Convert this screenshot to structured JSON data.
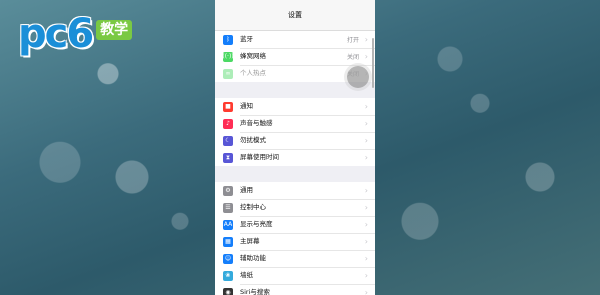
{
  "logo": {
    "text": "pc6",
    "badge": "教学"
  },
  "header": {
    "title": "设置"
  },
  "groups": [
    {
      "items": [
        {
          "label": "蓝牙",
          "value": "打开",
          "icon": "bluetooth-icon",
          "color": "#147efb",
          "glyph": "ᛒ"
        },
        {
          "label": "蜂窝网络",
          "value": "关闭",
          "icon": "antenna-icon",
          "color": "#4cd964",
          "glyph": "((·))"
        },
        {
          "label": "个人热点",
          "value": "关闭",
          "icon": "hotspot-icon",
          "color": "#4cd964",
          "glyph": "∞"
        }
      ]
    },
    {
      "items": [
        {
          "label": "通知",
          "value": "",
          "icon": "notification-icon",
          "color": "#ff3b30",
          "glyph": "■"
        },
        {
          "label": "声音与触感",
          "value": "",
          "icon": "sound-icon",
          "color": "#ff2d55",
          "glyph": "♪"
        },
        {
          "label": "勿扰模式",
          "value": "",
          "icon": "moon-icon",
          "color": "#5856d6",
          "glyph": "☾"
        },
        {
          "label": "屏幕使用时间",
          "value": "",
          "icon": "hourglass-icon",
          "color": "#5856d6",
          "glyph": "⧗"
        }
      ]
    },
    {
      "items": [
        {
          "label": "通用",
          "value": "",
          "icon": "gear-icon",
          "color": "#8e8e93",
          "glyph": "⚙"
        },
        {
          "label": "控制中心",
          "value": "",
          "icon": "control-center-icon",
          "color": "#8e8e93",
          "glyph": "☰"
        },
        {
          "label": "显示与亮度",
          "value": "",
          "icon": "display-icon",
          "color": "#147efb",
          "glyph": "AA"
        },
        {
          "label": "主屏幕",
          "value": "",
          "icon": "home-screen-icon",
          "color": "#147efb",
          "glyph": "▦"
        },
        {
          "label": "辅助功能",
          "value": "",
          "icon": "accessibility-icon",
          "color": "#147efb",
          "glyph": "☺"
        },
        {
          "label": "墙纸",
          "value": "",
          "icon": "wallpaper-icon",
          "color": "#34aadc",
          "glyph": "❀"
        },
        {
          "label": "Siri与搜索",
          "value": "",
          "icon": "siri-icon",
          "color": "#333333",
          "glyph": "◉"
        }
      ]
    }
  ]
}
